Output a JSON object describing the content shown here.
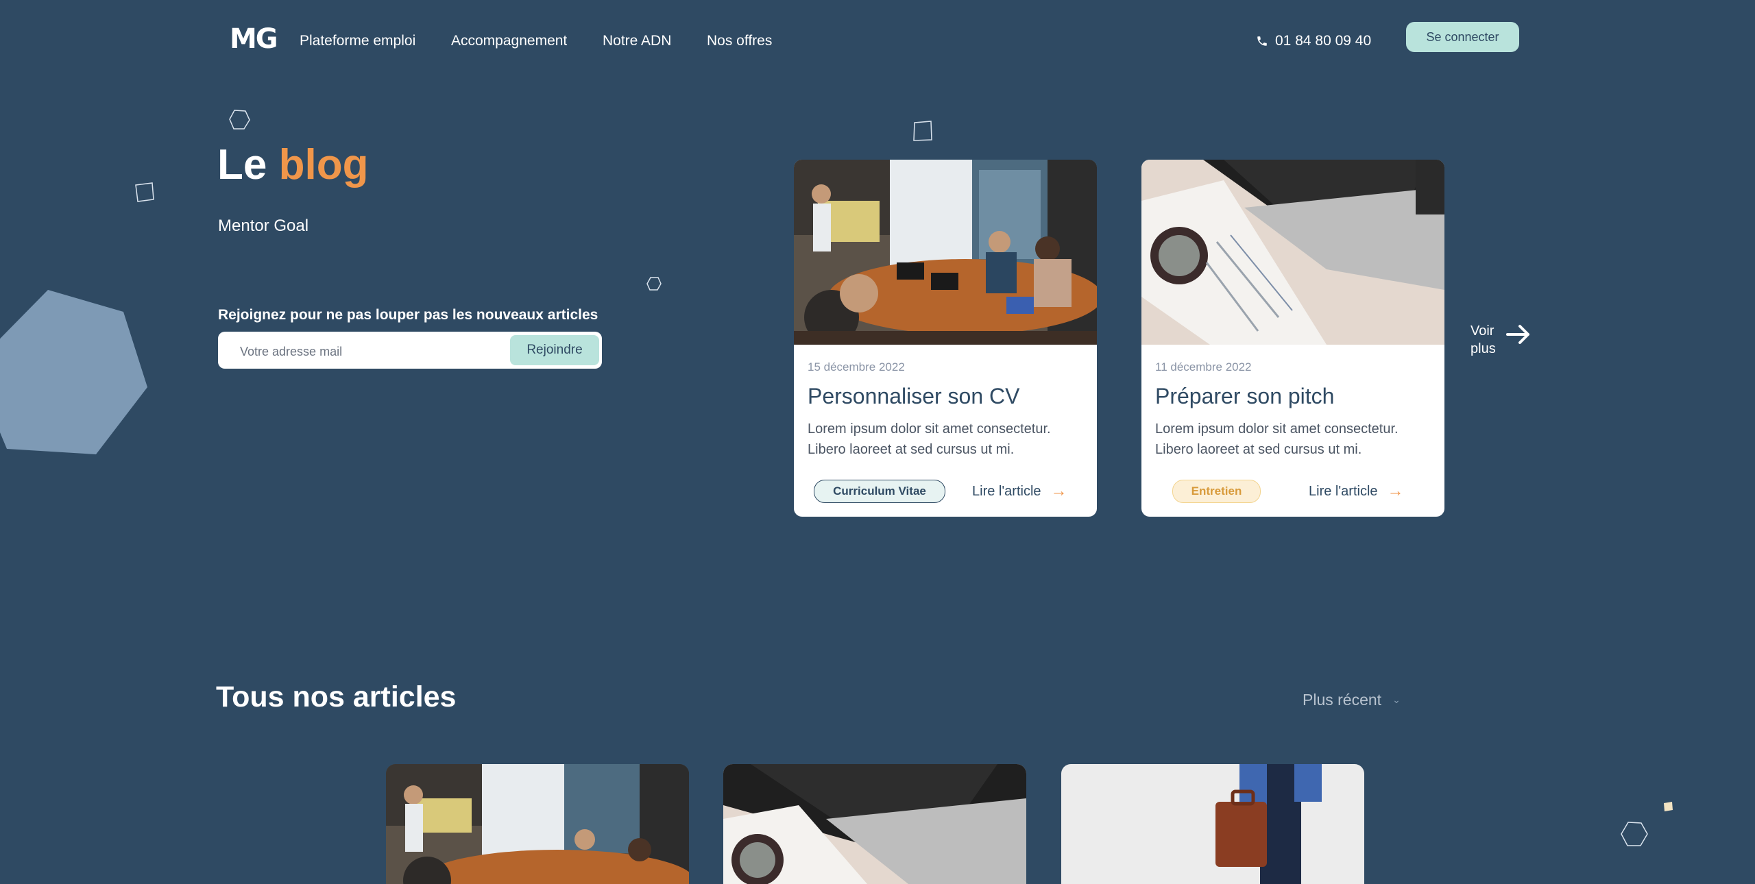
{
  "nav": {
    "logo": "MG",
    "links": [
      "Plateforme emploi",
      "Accompagnement",
      "Notre ADN",
      "Nos offres"
    ],
    "phone": "01 84 80 09 40",
    "login": "Se connecter"
  },
  "hero": {
    "title_prefix": "Le",
    "title_accent": "blog",
    "subtitle": "Mentor Goal",
    "join_label": "Rejoignez pour ne pas louper pas les nouveaux articles",
    "email_placeholder": "Votre adresse mail",
    "join_button": "Rejoindre"
  },
  "featured": [
    {
      "date": "15 décembre 2022",
      "title": "Personnaliser son CV",
      "text": "Lorem ipsum dolor sit amet consectetur. Libero laoreet at sed cursus ut mi.",
      "tag": "Curriculum Vitae",
      "read": "Lire l'article"
    },
    {
      "date": "11 décembre 2022",
      "title": "Préparer son pitch",
      "text": "Lorem ipsum dolor sit amet consectetur. Libero laoreet at sed cursus ut mi.",
      "tag": "Entretien",
      "read": "Lire l'article"
    }
  ],
  "see_more": "Voir plus",
  "articles": {
    "title": "Tous nos articles",
    "sort": "Plus récent"
  },
  "colors": {
    "background": "#2f4a63",
    "accent": "#f0964a",
    "mint": "#b9e3dc"
  }
}
